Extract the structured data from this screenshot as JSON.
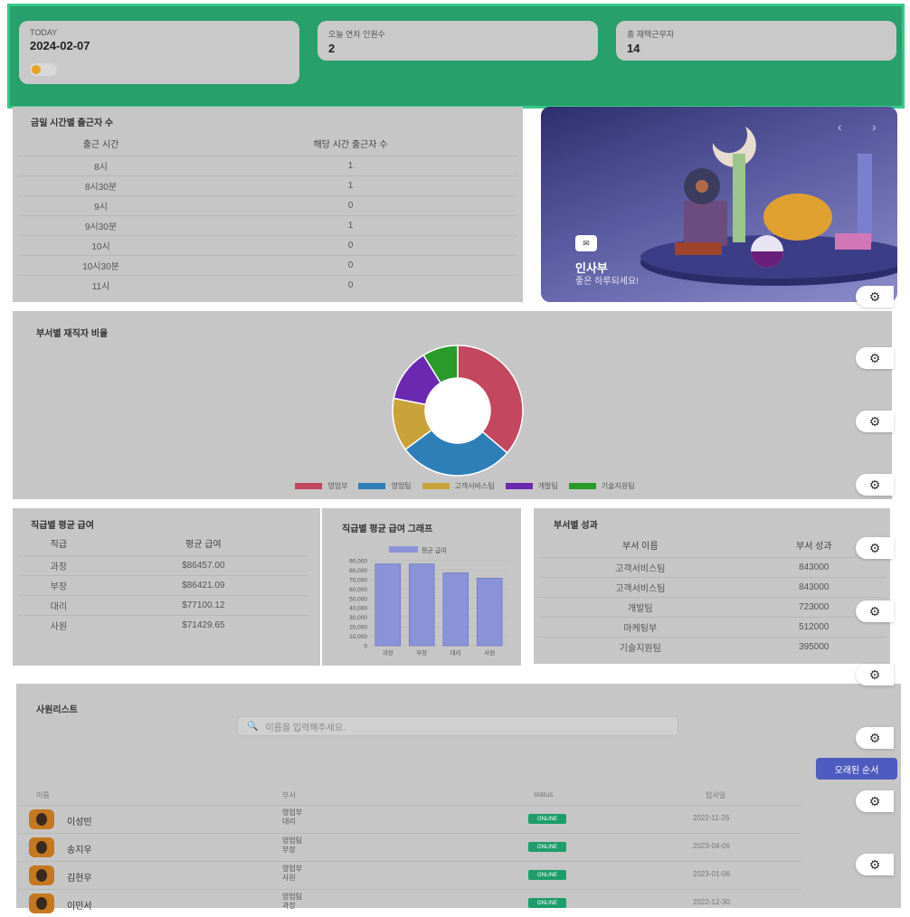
{
  "stats": {
    "today_label": "TODAY",
    "today_value": "2024-02-07",
    "leave_label": "오늘 연차 인원수",
    "leave_value": "2",
    "remote_label": "총 재택근무자",
    "remote_value": "14"
  },
  "checkin_table": {
    "title": "금일 시간별 출근자 수",
    "columns": [
      "출근 시간",
      "해당 시간 출근자 수"
    ],
    "rows": [
      [
        "8시",
        "1"
      ],
      [
        "8시30분",
        "1"
      ],
      [
        "9시",
        "0"
      ],
      [
        "9시30분",
        "1"
      ],
      [
        "10시",
        "0"
      ],
      [
        "10시30분",
        "0"
      ],
      [
        "11시",
        "0"
      ]
    ]
  },
  "hero": {
    "badge": "✉",
    "title": "인사부",
    "subtitle": "좋은 하루되세요!",
    "prev": "‹",
    "next": "›"
  },
  "dept_ratio": {
    "title": "부서별 재직자 비율",
    "chart_data": {
      "type": "pie",
      "variant": "donut",
      "labels": [
        "영업부",
        "영업팀",
        "고객서비스팀",
        "개발팀",
        "기술지원팀"
      ],
      "values": [
        33,
        26,
        12,
        12,
        8
      ],
      "colors": [
        "#c2475f",
        "#2e7fb8",
        "#c9a23a",
        "#6b28b0",
        "#2a9a2a"
      ]
    }
  },
  "salary_table": {
    "title": "직급별 평균 급여",
    "columns": [
      "직급",
      "평균 급여"
    ],
    "rows": [
      [
        "과장",
        "$86457.00"
      ],
      [
        "부장",
        "$86421.09"
      ],
      [
        "대리",
        "$77100.12"
      ],
      [
        "사원",
        "$71429.65"
      ]
    ]
  },
  "salary_chart": {
    "title": "직급별 평균 급여 그래프",
    "chart_data": {
      "type": "bar",
      "categories": [
        "과장",
        "부장",
        "대리",
        "사원"
      ],
      "series": [
        {
          "name": "평균 급여",
          "values": [
            86457,
            86421,
            77100,
            71430
          ]
        }
      ],
      "ylim": [
        0,
        90000
      ],
      "yticks": [
        "0",
        "10,000",
        "20,000",
        "30,000",
        "40,000",
        "50,000",
        "60,000",
        "70,000",
        "80,000",
        "90,000"
      ],
      "color": "#8b93d8"
    }
  },
  "dept_perf": {
    "title": "부서별 성과",
    "columns": [
      "부서 이름",
      "부서 성과"
    ],
    "rows": [
      [
        "고객서비스팀",
        "843000"
      ],
      [
        "고객서비스팀",
        "843000"
      ],
      [
        "개발팀",
        "723000"
      ],
      [
        "마케팅부",
        "512000"
      ],
      [
        "기술지원팀",
        "395000"
      ]
    ]
  },
  "employees": {
    "title": "사원리스트",
    "search_placeholder": "이름을 입력해주세요.",
    "sort_button": "오래된 순서",
    "columns": [
      "이름",
      "부서",
      "status",
      "입사일"
    ],
    "rows": [
      {
        "name": "이성빈",
        "dept": "영업부",
        "rank": "대리",
        "status": "ONLINE",
        "date": "2022-11-26"
      },
      {
        "name": "송지우",
        "dept": "영업팀",
        "rank": "부장",
        "status": "ONLINE",
        "date": "2023-04-06"
      },
      {
        "name": "김현우",
        "dept": "영업부",
        "rank": "사원",
        "status": "ONLINE",
        "date": "2023-01-06"
      },
      {
        "name": "이민서",
        "dept": "영업팀",
        "rank": "과장",
        "status": "ONLINE",
        "date": "2022-12-30"
      }
    ]
  },
  "icons": {
    "gear": "gear-icon",
    "search": "search-icon",
    "mail": "mail-icon"
  }
}
